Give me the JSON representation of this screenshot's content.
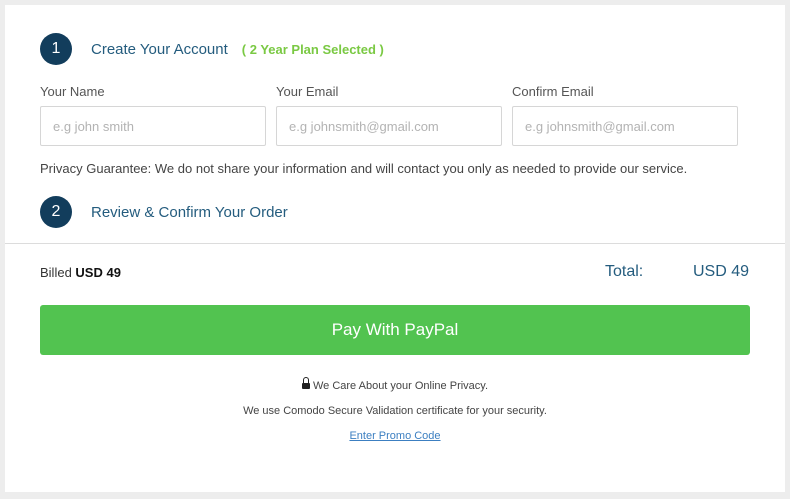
{
  "step1": {
    "number": "1",
    "title": "Create Your Account",
    "plan_note": "( 2 Year Plan Selected )"
  },
  "form": {
    "name_label": "Your Name",
    "name_placeholder": "e.g john smith",
    "email_label": "Your Email",
    "email_placeholder": "e.g johnsmith@gmail.com",
    "confirm_label": "Confirm Email",
    "confirm_placeholder": "e.g johnsmith@gmail.com"
  },
  "privacy_text": "Privacy Guarantee: We do not share your information and will contact you only as needed to provide our service.",
  "step2": {
    "number": "2",
    "title": "Review & Confirm Your Order"
  },
  "billing": {
    "billed_label": "Billed",
    "billed_amount": "USD 49",
    "total_label": "Total:",
    "total_amount": "USD 49"
  },
  "pay_button_label": "Pay With PayPal",
  "footer": {
    "privacy_care": "We Care About your Online Privacy.",
    "security_note": "We use Comodo Secure Validation certificate for your security.",
    "promo_link": "Enter Promo Code"
  },
  "colors": {
    "accent_dark": "#123d5c",
    "accent_text": "#245c7e",
    "plan_green": "#7ac943",
    "pay_green": "#52c350",
    "link_blue": "#3c7fc1"
  },
  "icons": {
    "privacy": "lock-icon"
  }
}
